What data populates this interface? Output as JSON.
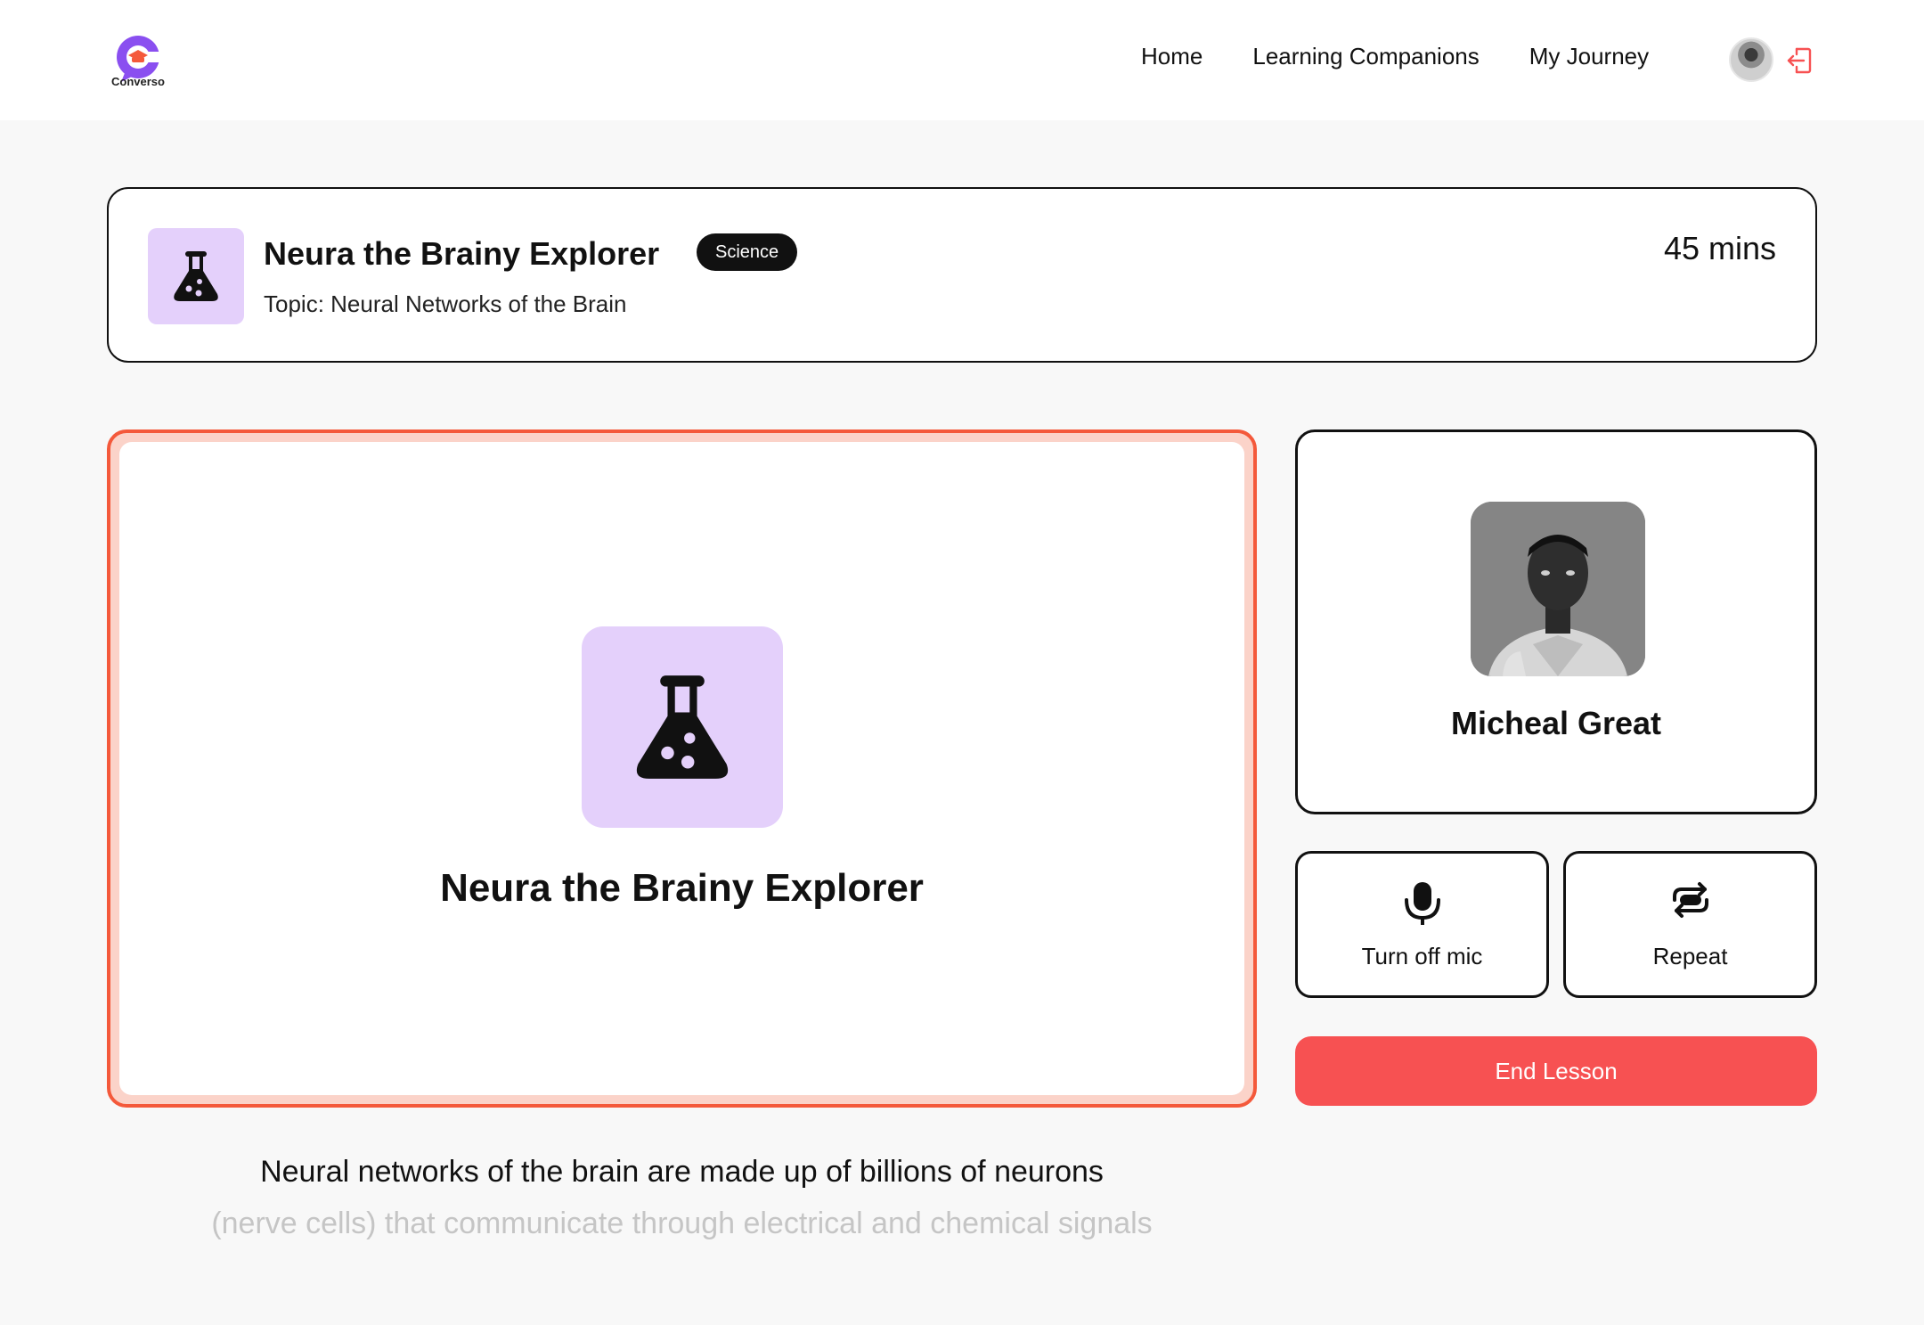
{
  "navbar": {
    "logo_text": "Converso",
    "links": [
      "Home",
      "Learning Companions",
      "My Journey"
    ]
  },
  "session": {
    "name": "Neura the Brainy Explorer",
    "subject": "Science",
    "topic": "Topic: Neural Networks of the Brain",
    "duration": "45 mins",
    "icon": "flask-icon"
  },
  "user": {
    "name": "Micheal Great"
  },
  "controls": {
    "mic_label": "Turn off mic",
    "repeat_label": "Repeat",
    "end_label": "End Lesson"
  },
  "transcript": {
    "current": "Neural networks of the brain are made up of billions of neurons",
    "upcoming": "(nerve cells) that communicate through electrical and chemical signals"
  },
  "colors": {
    "accent_purple": "#e4d0fb",
    "speaking_border": "#f4593b",
    "end_button": "#f75152",
    "logo_purple": "#8a4ff0"
  }
}
